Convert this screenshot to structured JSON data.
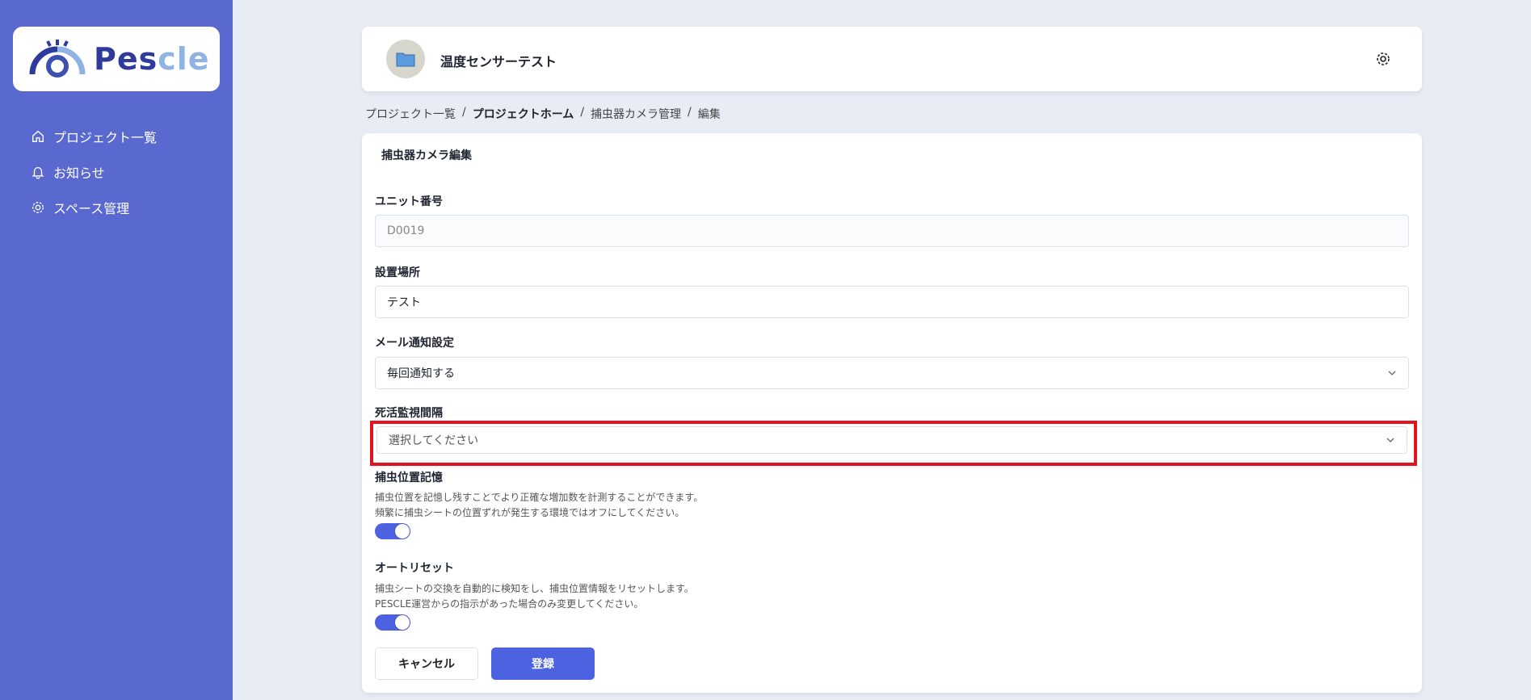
{
  "sidebar": {
    "logo_text_a": "Pes",
    "logo_text_b": "cle",
    "items": [
      {
        "label": "プロジェクト一覧",
        "icon": "home-icon"
      },
      {
        "label": "お知らせ",
        "icon": "bell-icon"
      },
      {
        "label": "スペース管理",
        "icon": "gear-icon"
      }
    ]
  },
  "header": {
    "project_title": "温度センサーテスト"
  },
  "breadcrumb": [
    "プロジェクト一覧",
    "プロジェクトホーム",
    "捕虫器カメラ管理",
    "編集"
  ],
  "breadcrumb_sep": "/",
  "form": {
    "title": "捕虫器カメラ編集",
    "unit_label": "ユニット番号",
    "unit_value": "D0019",
    "location_label": "設置場所",
    "location_value": "テスト",
    "mail_label": "メール通知設定",
    "mail_value": "毎回通知する",
    "alive_label": "死活監視間隔",
    "alive_placeholder": "選択してください",
    "memory_label": "捕虫位置記憶",
    "memory_desc1": "捕虫位置を記憶し残すことでより正確な増加数を計測することができます。",
    "memory_desc2": "頻繁に捕虫シートの位置ずれが発生する環境ではオフにしてください。",
    "memory_on": true,
    "reset_label": "オートリセット",
    "reset_desc1": "捕虫シートの交換を自動的に検知をし、捕虫位置情報をリセットします。",
    "reset_desc2": "PESCLE運営からの指示があった場合のみ変更してください。",
    "reset_on": true,
    "cancel_label": "キャンセル",
    "submit_label": "登録"
  },
  "colors": {
    "sidebar": "#5a69d0",
    "accent": "#4c62e0",
    "highlight": "#e3121e"
  }
}
